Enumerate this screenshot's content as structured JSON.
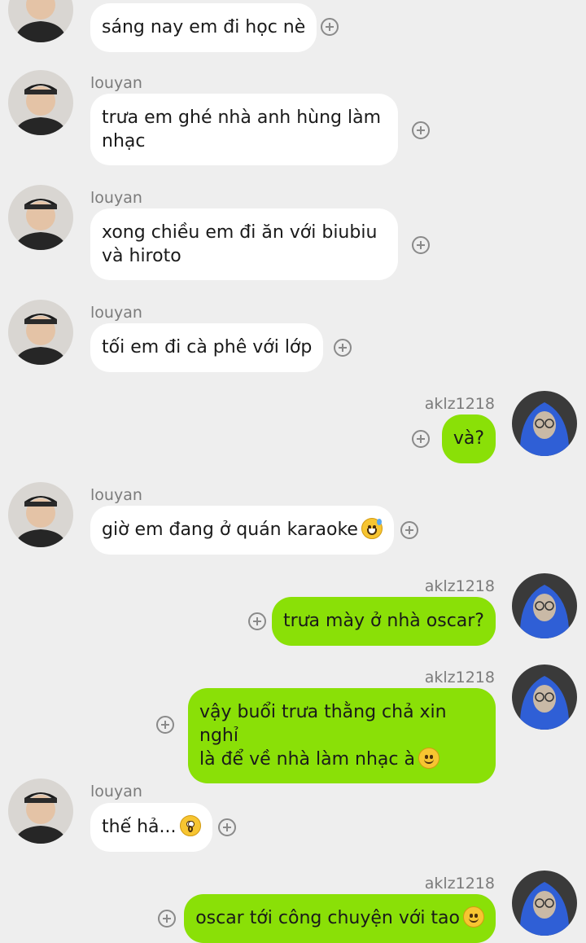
{
  "chat": {
    "messages": [
      {
        "side": "in",
        "name": "",
        "text": "sáng nay em đi học nè",
        "emoji": ""
      },
      {
        "side": "in",
        "name": "louyan",
        "text": "trưa em ghé nhà anh hùng làm\nnhạc",
        "emoji": ""
      },
      {
        "side": "in",
        "name": "louyan",
        "text": "xong chiều em đi ăn với biubiu\nvà hiroto",
        "emoji": ""
      },
      {
        "side": "in",
        "name": "louyan",
        "text": "tối em đi cà phê với lớp",
        "emoji": ""
      },
      {
        "side": "out",
        "name": "aklz1218",
        "text": "và?",
        "emoji": ""
      },
      {
        "side": "in",
        "name": "louyan",
        "text": "giờ em đang ở quán karaoke",
        "emoji": "grinning-sweat-emoji"
      },
      {
        "side": "out",
        "name": "aklz1218",
        "text": "trưa mày ở nhà oscar?",
        "emoji": ""
      },
      {
        "side": "out",
        "name": "aklz1218",
        "text": "vậy buổi trưa thằng chả xin nghỉ\nlà để về nhà làm nhạc à",
        "emoji": "smiling-emoji"
      },
      {
        "side": "in",
        "name": "louyan",
        "text": "thế hả...",
        "emoji": "flushed-emoji"
      },
      {
        "side": "out",
        "name": "aklz1218",
        "text": "oscar tới công chuyện với tao",
        "emoji": "smiling-emoji"
      }
    ]
  },
  "colors": {
    "background": "#eeeeee",
    "incoming_bubble": "#ffffff",
    "outgoing_bubble": "#8ae007",
    "name_text": "#7b7b7b"
  }
}
